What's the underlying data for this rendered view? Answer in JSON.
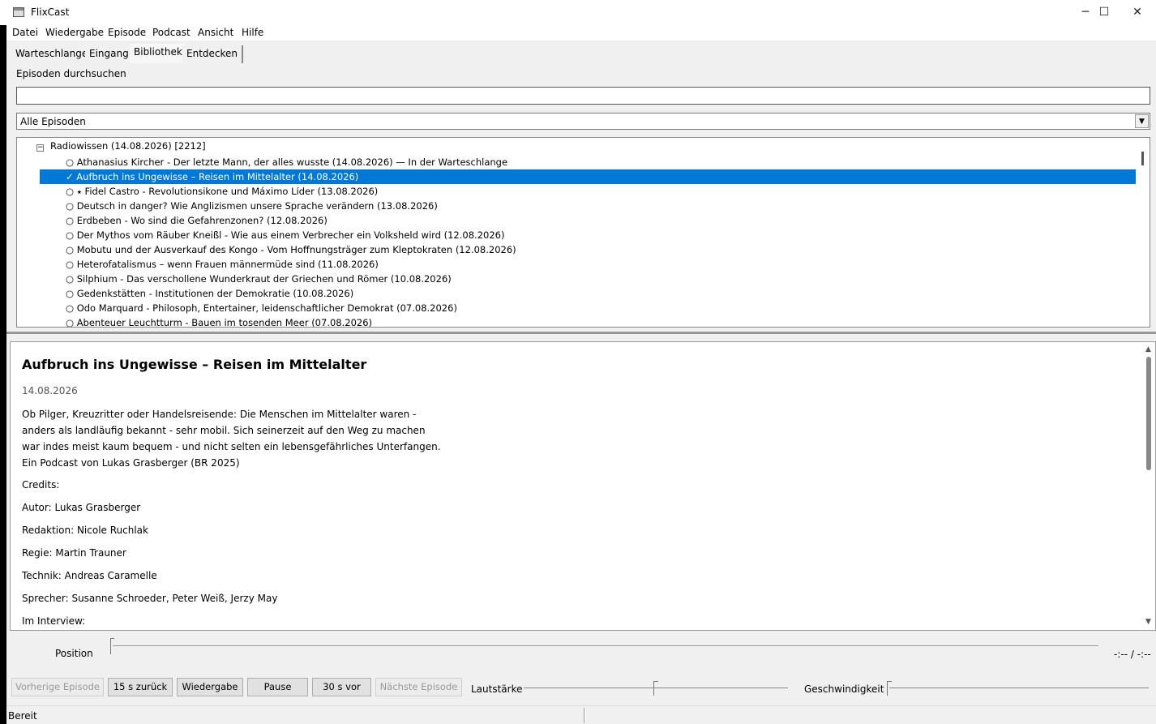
{
  "window": {
    "title": "FlixCast",
    "minimize_glyph": "─",
    "maximize_glyph": "☐",
    "close_glyph": "✕"
  },
  "menu": [
    "Datei",
    "Wiedergabe",
    "Episode",
    "Podcast",
    "Ansicht",
    "Hilfe"
  ],
  "tabs": [
    "Warteschlange",
    "Eingang",
    "Bibliothek",
    "Entdecken"
  ],
  "active_tab": "Bibliothek",
  "search": {
    "label": "Episoden durchsuchen",
    "value": ""
  },
  "filter": {
    "selected": "Alle Episoden"
  },
  "tree": {
    "group": {
      "expander": "−",
      "label": "Radiowissen  (14.08.2026) [2212]"
    },
    "episodes": [
      "○ Athanasius Kircher - Der letzte Mann, der alles wusste (14.08.2026) — In der Warteschlange",
      "✓ Aufbruch ins Ungewisse – Reisen im Mittelalter (14.08.2026)",
      "○ ⭑ Fidel Castro - Revolutionsikone und Máximo Líder (13.08.2026)",
      "○ Deutsch in danger? Wie Anglizismen unsere Sprache verändern (13.08.2026)",
      "○ Erdbeben - Wo sind die Gefahrenzonen? (12.08.2026)",
      "○ Der Mythos vom Räuber Kneißl - Wie aus einem Verbrecher ein Volksheld wird (12.08.2026)",
      "○ Mobutu und der Ausverkauf des Kongo - Vom Hoffnungsträger zum Kleptokraten (12.08.2026)",
      "○ Heterofatalismus – wenn Frauen männermüde sind (11.08.2026)",
      "○ Silphium - Das verschollene Wunderkraut der Griechen und Römer (10.08.2026)",
      "○ Gedenkstätten - Institutionen der Demokratie (10.08.2026)",
      "○ Odo Marquard - Philosoph, Entertainer, leidenschaftlicher Demokrat (07.08.2026)",
      "○ Abenteuer Leuchtturm - Bauen im tosenden Meer (07.08.2026)"
    ],
    "selected_index": 1
  },
  "detail": {
    "title": "Aufbruch ins Ungewisse – Reisen im Mittelalter",
    "date": "14.08.2026",
    "description_lines": [
      "Ob Pilger, Kreuzritter oder Handelsreisende: Die Menschen im Mittelalter waren -",
      "anders als landläufig bekannt - sehr mobil. Sich seinerzeit auf den Weg zu machen",
      "war indes meist kaum bequem - und nicht selten ein lebensgefährliches Unterfangen.",
      "Ein Podcast von Lukas Grasberger (BR 2025)"
    ],
    "credits_heading": "Credits:",
    "credits": [
      "Autor: Lukas Grasberger",
      "Redaktion: Nicole Ruchlak",
      "Regie: Martin Trauner",
      "Technik: Andreas Caramelle",
      "Sprecher: Susanne Schroeder, Peter Weiß, Jerzy May",
      "Im Interview:"
    ]
  },
  "player": {
    "position_label": "Position",
    "position_fraction": 0,
    "time": "-:-- / -:--",
    "buttons": {
      "prev": "Vorherige Episode",
      "back15": "15 s zurück",
      "play": "Wiedergabe",
      "pause": "Pause",
      "fwd30": "30 s vor",
      "next": "Nächste Episode"
    },
    "volume_label": "Lautstärke",
    "volume_fraction": 0.5,
    "speed_label": "Geschwindigkeit",
    "speed_fraction": 0
  },
  "status": {
    "text": "Bereit"
  },
  "colors": {
    "selection": "#0078d7",
    "window_bg": "#f0f0f0"
  }
}
